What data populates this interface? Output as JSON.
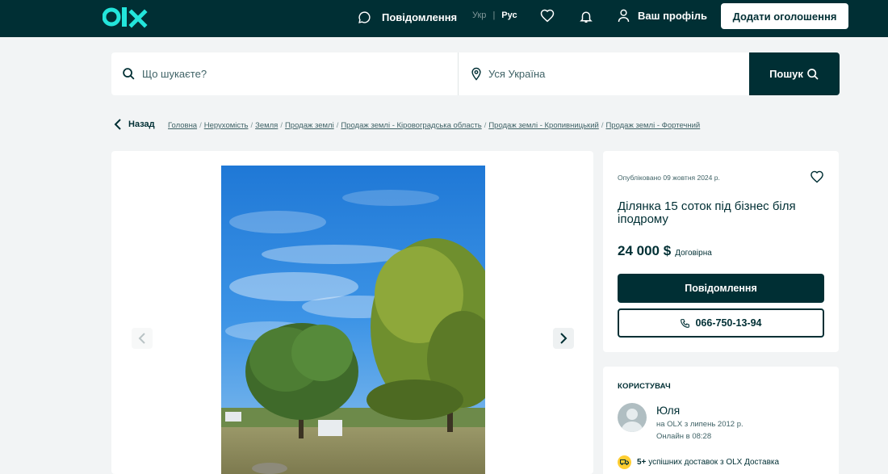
{
  "header": {
    "messages_label": "Повідомлення",
    "lang_ukr": "Укр",
    "lang_separator": "|",
    "lang_rus": "Рус",
    "profile_label": "Ваш профіль",
    "add_listing_label": "Додати оголошення"
  },
  "search": {
    "query_placeholder": "Що шукаєте?",
    "location_value": "Уся Україна",
    "search_button_label": "Пошук"
  },
  "breadcrumb": {
    "back_label": "Назад",
    "items": [
      "Головна",
      "Нерухомість",
      "Земля",
      "Продаж землі",
      "Продаж землі - Кіровоградська область",
      "Продаж землі - Кропивницький",
      "Продаж землі - Фортечний"
    ]
  },
  "ad": {
    "posted": "Опубліковано 09 жовтня 2024 р.",
    "title": "Ділянка 15 соток під бізнес біля іподрому",
    "price": "24 000 $",
    "price_note": "Договірна",
    "message_button_label": "Повідомлення",
    "phone_button_label": "066-750-13-94"
  },
  "user": {
    "section_label": "КОРИСТУВАЧ",
    "name": "Юля",
    "member_since": "на OLX з липень 2012 р.",
    "last_online": "Онлайн в 08:28",
    "delivery_count": "5+",
    "delivery_text": "успішних доставок з OLX Доставка"
  },
  "colors": {
    "brand_dark": "#002f34",
    "logo_accent": "#23e5db",
    "page_bg": "#f2f4f5",
    "delivery_badge": "#ffce32"
  }
}
